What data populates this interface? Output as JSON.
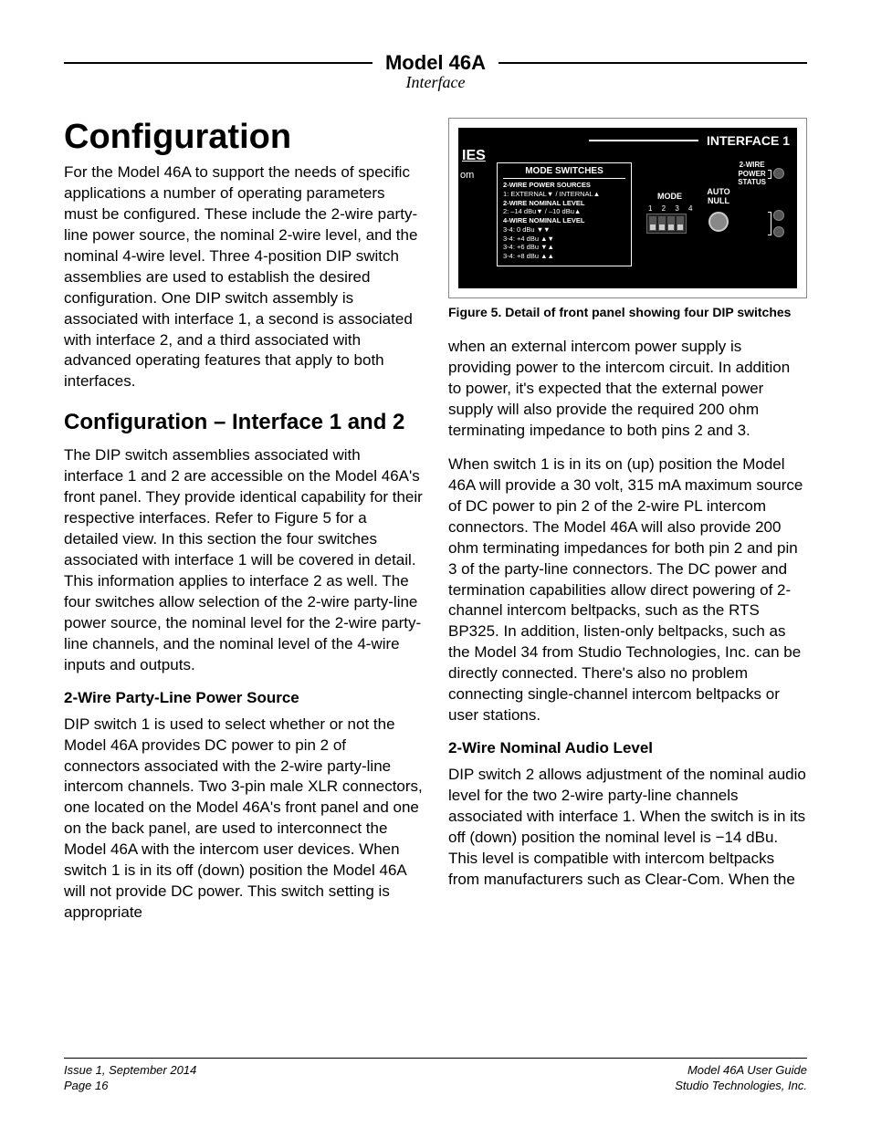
{
  "header": {
    "title": "Model 46A",
    "subtitle": "Interface"
  },
  "h1": "Configuration",
  "intro": "For the Model 46A to support the needs of specific applications a number of operating parameters must be configured. These include the 2-wire party-line power source, the nominal 2-wire level, and the nominal 4-wire level. Three 4-position DIP switch assemblies are used to establish the desired configuration. One DIP switch assembly is associated with interface 1, a second is associated with interface 2, and a third associated with advanced operating features that apply to both interfaces.",
  "h2": "Configuration – Interface 1 and 2",
  "p2": "The DIP switch assemblies associated with interface 1 and 2 are accessible on the Model 46A's front panel. They provide identical capability for their respective interfaces. Refer to Figure 5 for a detailed view. In this section the four switches associated with interface 1 will be covered in detail. This information applies to interface 2 as well. The four switches allow selection of the 2-wire party-line power source, the nominal level for the 2-wire party-line channels, and the nominal level of the 4-wire inputs and outputs.",
  "h3a": "2-Wire Party-Line Power Source",
  "p3": "DIP switch 1 is used to select whether or not the Model 46A provides DC power to pin 2 of connectors associated with the 2-wire party-line intercom channels. Two 3-pin male XLR connectors, one located on the Model 46A's front panel and one on the back panel, are used to interconnect the Model 46A with the intercom user devices. When switch 1 is in its off (down) position the Model 46A will not provide DC power. This switch setting is appropriate",
  "figure": {
    "interface": "INTERFACE 1",
    "ies": "IES",
    "om": "om",
    "modeTitle": "MODE SWITCHES",
    "modeLines": [
      "2-WIRE POWER SOURCES",
      "  1: EXTERNAL▼ / INTERNAL▲",
      "2-WIRE NOMINAL LEVEL",
      "  2: –14 dBu▼ / –10 dBu▲",
      "4-WIRE NOMINAL LEVEL",
      "  3-4:  0 dBu ▼▼",
      "  3-4: +4 dBu ▲▼",
      "  3-4: +6 dBu ▼▲",
      "  3-4: +8 dBu ▲▲"
    ],
    "modeLabel": "MODE",
    "dipNums": "1 2 3 4",
    "autoNull": "AUTO NULL",
    "wireLabel": "2-WIRE\nPOWER\nSTATUS"
  },
  "figCaption": "Figure 5. Detail of front panel showing four DIP switches",
  "p4": "when an external intercom power supply is providing power to the intercom circuit. In addition to power, it's expected that the external power supply will also provide the required 200 ohm terminating impedance to both pins 2 and 3.",
  "p5": "When switch 1 is in its on (up) position the Model 46A will provide a 30 volt, 315 mA maximum source of DC power to pin 2 of the 2-wire PL intercom connectors. The Model 46A will also provide 200 ohm terminating impedances for both pin 2 and pin 3 of the party-line connectors. The DC power and termination capabilities allow direct powering of 2-channel intercom beltpacks, such as the RTS BP325. In addition, listen-only beltpacks, such as the Model 34 from Studio Technologies, Inc. can be directly connected. There's also no problem connecting single-channel intercom beltpacks or user stations.",
  "h3b": "2-Wire Nominal Audio Level",
  "p6": "DIP switch 2 allows adjustment of the nominal audio level for the two 2-wire party-line channels associated with interface 1. When the switch is in its off (down) position the nominal level is −14 dBu. This level is compatible with intercom beltpacks from manufacturers such as Clear-Com. When the",
  "footer": {
    "issue": "Issue 1, September 2014",
    "page": "Page 16",
    "guide": "Model 46A User Guide",
    "company": "Studio Technologies, Inc."
  }
}
